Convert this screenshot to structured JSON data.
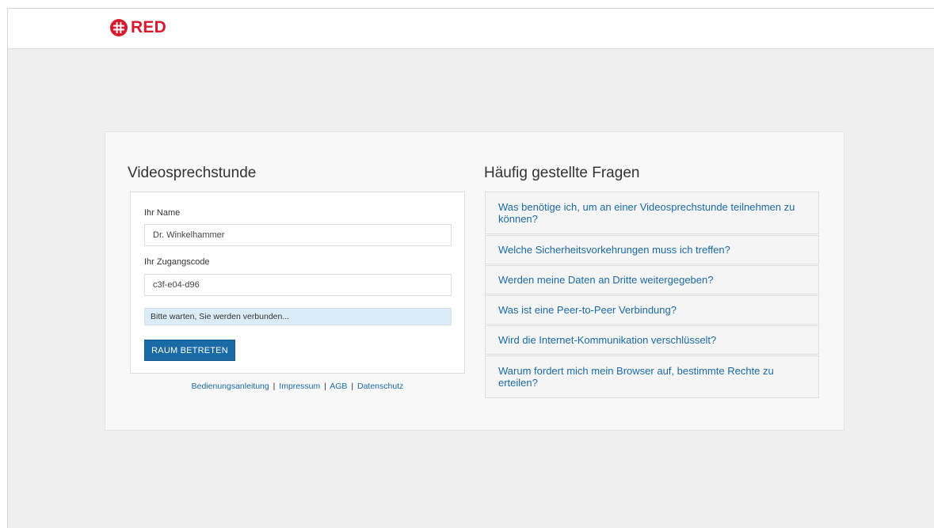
{
  "brand": {
    "name": "RED",
    "color": "#d7192d"
  },
  "login": {
    "title": "Videosprechstunde",
    "name_label": "Ihr Name",
    "name_value": "Dr. Winkelhammer",
    "code_label": "Ihr Zugangscode",
    "code_value": "c3f-e04-d96",
    "status_message": "Bitte warten, Sie werden verbunden...",
    "submit_label": "RAUM BETRETEN",
    "accent_color": "#1a6aa6"
  },
  "footer": {
    "links": [
      "Bedienungsanleitung",
      "Impressum",
      "AGB",
      "Datenschutz"
    ],
    "separator": "|"
  },
  "faq": {
    "title": "Häufig gestellte Fragen",
    "items": [
      "Was benötige ich, um an einer Videosprechstunde teilnehmen zu können?",
      "Welche Sicherheitsvorkehrungen muss ich treffen?",
      "Werden meine Daten an Dritte weitergegeben?",
      "Was ist eine Peer-to-Peer Verbindung?",
      "Wird die Internet-Kommunikation verschlüsselt?",
      "Warum fordert mich mein Browser auf, bestimmte Rechte zu erteilen?"
    ]
  }
}
